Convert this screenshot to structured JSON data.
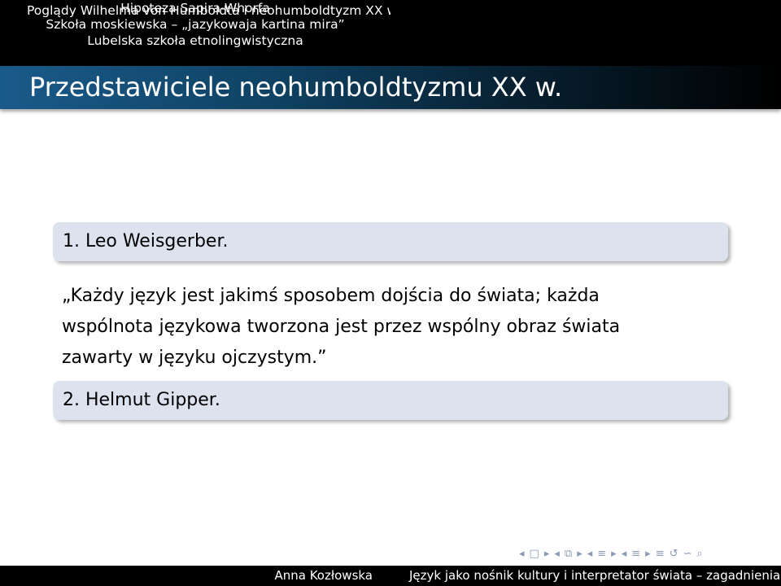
{
  "header": {
    "section": "Poglądy Wilhelma von Humboldta i neohumboldtyzm XX w.",
    "subsections": [
      "Hipoteza Sapira-Whorfa",
      "Szkoła moskiewska – „jazykowaja kartina mira”",
      "Lubelska szkoła etnolingwistyczna"
    ]
  },
  "frame": {
    "title": "Przedstawiciele neohumboldtyzmu XX w."
  },
  "content": {
    "block1": "1. Leo Weisgerber.",
    "quote_lines": [
      "„Każdy język jest jakimś sposobem dojścia do świata; każda",
      "wspólnota językowa tworzona jest przez wspólny obraz świata",
      "zawarty w języku ojczystym.”"
    ],
    "block2": "2. Helmut Gipper."
  },
  "nav_symbols": [
    "◂",
    "□",
    "▸",
    "◂",
    "⧉",
    "▸",
    "◂",
    "≡",
    "▸",
    "◂",
    "≡",
    "▸",
    "≡",
    "↺",
    "∽",
    "⌕"
  ],
  "footer": {
    "author": "Anna Kozłowska",
    "title": "Język jako nośnik kultury i interpretator świata – zagadnienia etn"
  }
}
